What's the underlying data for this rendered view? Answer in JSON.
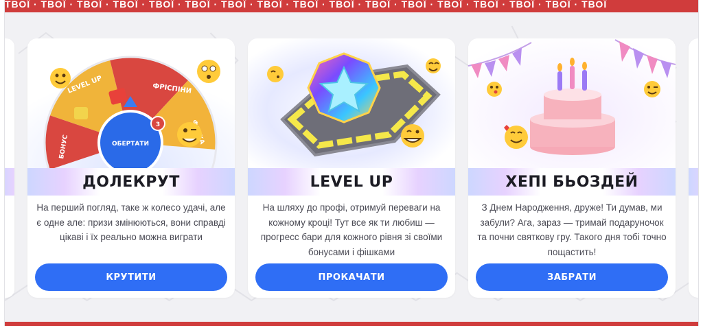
{
  "ticker": {
    "text": "ТВОЇ · ТВОЇ · ТВОЇ · ТВОЇ · ТВОЇ · ТВОЇ · ТВОЇ · ТВОЇ · ТВОЇ · ТВОЇ · ТВОЇ · ТВОЇ · ТВОЇ · ТВОЇ · ТВОЇ · ТВОЇ · ТВОЇ"
  },
  "cards": [
    {
      "title": "ДОЛЕКРУТ",
      "description": "На перший погляд, таке ж колесо удачі, але є одне але: призи змінюються, вони справді цікаві і їх реально можна виграти",
      "button": "КРУТИТИ",
      "wheel": {
        "segments": [
          "LEVEL UP",
          "ФРІСПІНИ",
          "БОНУС",
          "ФОТКА"
        ],
        "center_label": "ОБЕРТАТИ",
        "badge": "3"
      }
    },
    {
      "title": "LEVEL UP",
      "description": "На шляху до профі, отримуй переваги на кожному кроці! Тут все як ти любиш — прогресс бари для кожного рівня зі своїми бонусами і фішками",
      "button": "ПРОКАЧАТИ"
    },
    {
      "title": "ХЕПІ БЬОЗДЕЙ",
      "description": "З Днем Народження, друже! Ти думав, ми забули? Ага, зараз — тримай подаруночок та почни святкову гру. Такого дня тобі точно пощастить!",
      "button": "ЗАБРАТИ"
    }
  ],
  "colors": {
    "accent": "#2f6ef5",
    "ticker": "#d03c3c",
    "background": "#f1f1f4"
  }
}
